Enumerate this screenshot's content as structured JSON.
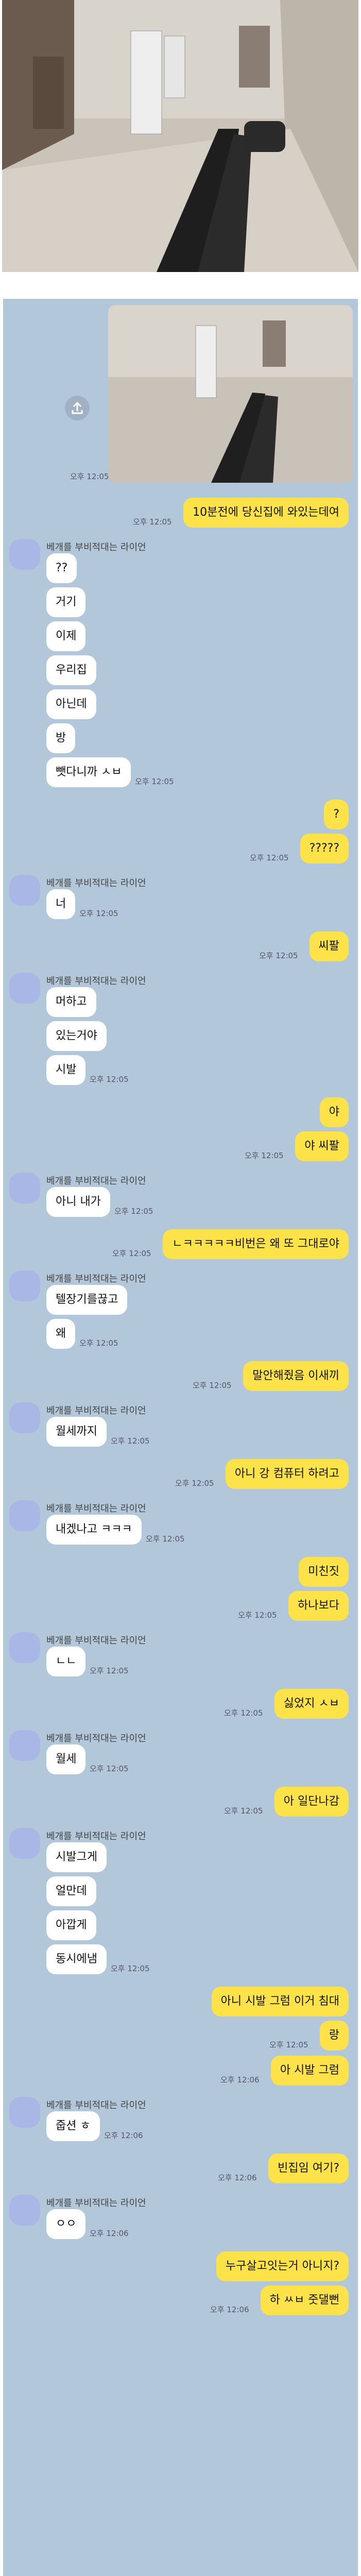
{
  "sender_name": "베개를 부비적대는 라이언",
  "messages": [
    {
      "side": "out",
      "text": "10분전에 당신집에 와있는데여",
      "time": "오후 12:05"
    },
    {
      "side": "in",
      "text": "??",
      "time": ""
    },
    {
      "side": "in",
      "text": "거기",
      "time": ""
    },
    {
      "side": "in",
      "text": "이제",
      "time": ""
    },
    {
      "side": "in",
      "text": "우리집",
      "time": ""
    },
    {
      "side": "in",
      "text": "아닌데",
      "time": ""
    },
    {
      "side": "in",
      "text": "방",
      "time": ""
    },
    {
      "side": "in",
      "text": "뺏다니까 ㅅㅂ",
      "time": "오후 12:05"
    },
    {
      "side": "out",
      "text": "?",
      "time": ""
    },
    {
      "side": "out",
      "text": "?????",
      "time": "오후 12:05"
    },
    {
      "side": "in",
      "text": "너",
      "time": "오후 12:05"
    },
    {
      "side": "out",
      "text": "씨팔",
      "time": "오후 12:05"
    },
    {
      "side": "in",
      "text": "머하고",
      "time": ""
    },
    {
      "side": "in",
      "text": "있는거야",
      "time": ""
    },
    {
      "side": "in",
      "text": "시발",
      "time": "오후 12:05"
    },
    {
      "side": "out",
      "text": "야",
      "time": ""
    },
    {
      "side": "out",
      "text": "야 씨팔",
      "time": "오후 12:05"
    },
    {
      "side": "in",
      "text": "아니 내가",
      "time": "오후 12:05"
    },
    {
      "side": "out",
      "text": "ㄴㅋㅋㅋㅋㅋ비번은 왜 또 그대로야",
      "time": "오후 12:05"
    },
    {
      "side": "in",
      "text": "텔장기를끊고",
      "time": ""
    },
    {
      "side": "in",
      "text": "왜",
      "time": "오후 12:05"
    },
    {
      "side": "out",
      "text": "말안해줬음 이새끼",
      "time": "오후 12:05"
    },
    {
      "side": "in",
      "text": "월세까지",
      "time": "오후 12:05"
    },
    {
      "side": "out",
      "text": "아니 강 컴퓨터 하려고",
      "time": "오후 12:05"
    },
    {
      "side": "in",
      "text": "내겠나고 ㅋㅋㅋ",
      "time": "오후 12:05"
    },
    {
      "side": "out",
      "text": "미친짓",
      "time": ""
    },
    {
      "side": "out",
      "text": "하나보다",
      "time": "오후 12:05"
    },
    {
      "side": "in",
      "text": "ㄴㄴ",
      "time": "오후 12:05"
    },
    {
      "side": "out",
      "text": "싫었지 ㅅㅂ",
      "time": "오후 12:05"
    },
    {
      "side": "in",
      "text": "월세",
      "time": "오후 12:05"
    },
    {
      "side": "out",
      "text": "아 일단나감",
      "time": "오후 12:05"
    },
    {
      "side": "in",
      "text": "시발그게",
      "time": ""
    },
    {
      "side": "in",
      "text": "얼만데",
      "time": ""
    },
    {
      "side": "in",
      "text": "아깝게",
      "time": ""
    },
    {
      "side": "in",
      "text": "동시에냄",
      "time": "오후 12:05"
    },
    {
      "side": "out",
      "text": "아니 시발 그럼 이거 침대",
      "time": ""
    },
    {
      "side": "out",
      "text": "랑",
      "time": "오후 12:05"
    },
    {
      "side": "out",
      "text": "아 시발 그럼",
      "time": "오후 12:06"
    },
    {
      "side": "in",
      "text": "줍션 ㅎ",
      "time": "오후 12:06"
    },
    {
      "side": "out",
      "text": "빈집임 여기?",
      "time": "오후 12:06"
    },
    {
      "side": "in",
      "text": "ㅇㅇ",
      "time": "오후 12:06"
    },
    {
      "side": "out",
      "text": "누구살고잇는거 아니지?",
      "time": ""
    },
    {
      "side": "out",
      "text": "하 ㅆㅂ 줏댈뻔",
      "time": "오후 12:06"
    }
  ],
  "photo_time": "오후 12:05",
  "colors": {
    "chat_bg": "#b2c7d9",
    "out_bubble": "#fde24a",
    "in_bubble": "#ffffff"
  }
}
